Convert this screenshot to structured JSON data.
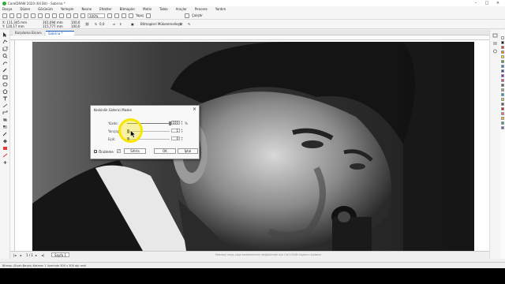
{
  "window": {
    "title": "CorelDRAW 2020 (64 Bit) - Sabrina *",
    "controls": [
      "–",
      "□",
      "×"
    ]
  },
  "menu": [
    "Dosya",
    "Düzen",
    "Görünüm",
    "Yerleşim",
    "Nesne",
    "Efektler",
    "Bitmapler",
    "Metin",
    "Tablo",
    "Araçlar",
    "Pencere",
    "Yardım"
  ],
  "toolbar": {
    "zoom": "100%",
    "snap": "Yapış",
    "launch": "Çalıştır"
  },
  "propbar": {
    "x": "X: 111,345 mm",
    "y": "Y: 120,17 mm",
    "w": "161,094 mm",
    "h": "115,777 mm",
    "scale_w": "100,0",
    "scale_h": "100,0",
    "angle": "0,0",
    "edit_bitmap": "Bitmapleri Mükemmelleştir"
  },
  "tabs": [
    "Karşılama Ekranı",
    "Sabrina *"
  ],
  "dialog": {
    "title": "Keskinlik Giderici Maske",
    "close": "×",
    "rows": [
      {
        "label": "Yüzde:",
        "value": "100",
        "unit": "%",
        "level": 1.0
      },
      {
        "label": "Yarıçap:",
        "value": "1",
        "unit": "",
        "level": 0.02
      },
      {
        "label": "Eşik:",
        "value": "0",
        "unit": "",
        "level": 0.0
      }
    ],
    "preview_label": "Önizleme",
    "preview_checked": "✓",
    "buttons": {
      "reset": "Sıfırla",
      "ok": "OK",
      "cancel": "İptal"
    }
  },
  "page_tab": "Sayfa 1",
  "hint": "Nesneyi veya çizgi karakterlerini değiştirmek için Ctrl+Shift tuşlarını kullanın",
  "status": "Bitmap (Siyah-Beyaz) Katman 1 üzerinde 300 x 300 dpi renk",
  "palette": [
    "#ffffff",
    "#000000",
    "#e53935",
    "#ff7f00",
    "#ffe000",
    "#43a047",
    "#1e88e5",
    "#3949ab",
    "#8e24aa",
    "#ec407a",
    "#795548",
    "#9e9e9e",
    "#00acc1",
    "#c0ca33",
    "#6d4c41",
    "#b71c1c",
    "#f06292",
    "#ffb300",
    "#26a69a",
    "#5c6bc0"
  ]
}
